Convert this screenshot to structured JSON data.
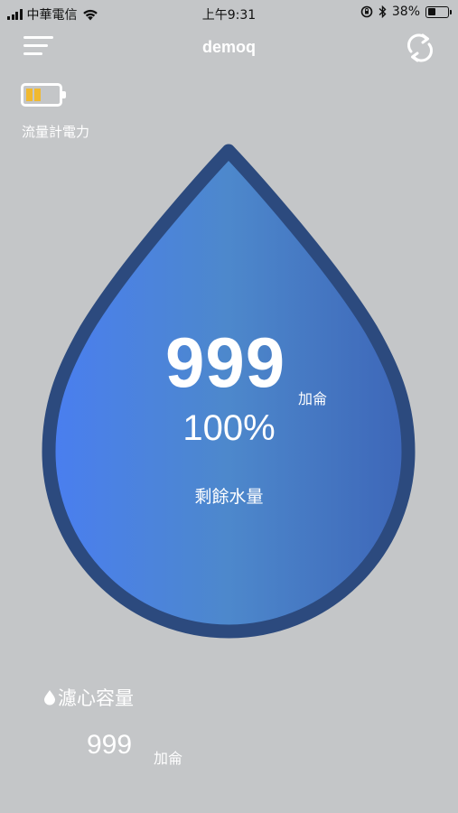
{
  "status_bar": {
    "carrier": "中華電信",
    "time": "上午9:31",
    "battery_percent": "38%",
    "battery_level": 0.38
  },
  "nav": {
    "title": "demoq",
    "menu_icon": "hamburger-menu-icon",
    "refresh_icon": "refresh-icon"
  },
  "flow_meter": {
    "label": "流量計電力",
    "battery_icon": "battery-icon",
    "battery_level": 0.5,
    "accent_color": "#f0b930"
  },
  "water": {
    "remaining_value": "999",
    "remaining_unit": "加侖",
    "percent": "100%",
    "label": "剩餘水量",
    "gradient_start": "#4a7ef0",
    "gradient_end": "#3d66b8",
    "border_color": "#2c4a7e"
  },
  "filter": {
    "title": "濾心容量",
    "value": "999",
    "unit": "加侖",
    "icon": "water-drop-icon"
  }
}
